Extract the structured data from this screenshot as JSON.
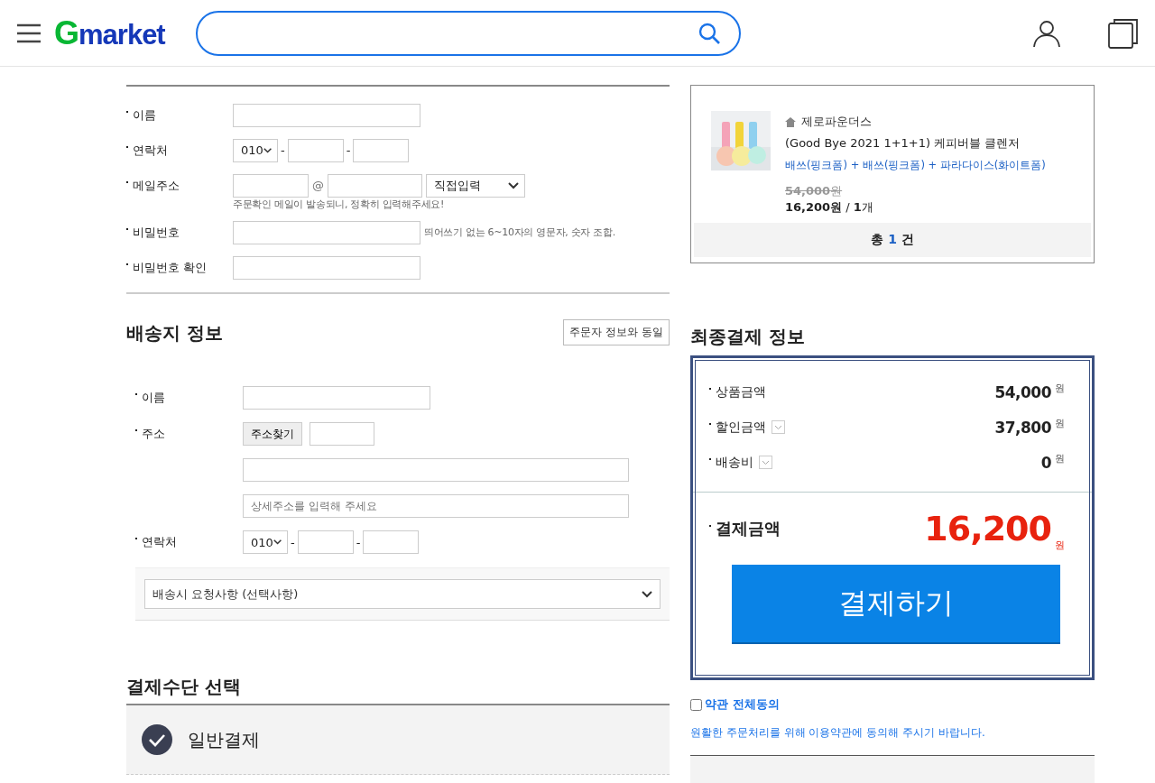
{
  "header": {
    "logo": {
      "mark": "G",
      "text": "market"
    }
  },
  "orderer": {
    "fields": [
      {
        "kind": "text",
        "label": "이름"
      },
      {
        "kind": "phone",
        "label": "연락처",
        "prefix": "010",
        "dash": "-"
      },
      {
        "kind": "email",
        "label": "메일주소",
        "at": "@",
        "domain": "직접입력",
        "note": "주문확인 메일이 발송되니, 정확히 입력해주세요!"
      },
      {
        "kind": "text",
        "label": "비밀번호",
        "hint": "띄어쓰기 없는 6~10자의 영문자, 숫자 조합."
      },
      {
        "kind": "text",
        "label": "비밀번호 확인"
      }
    ]
  },
  "delivery": {
    "title": "배송지 정보",
    "same_button": "주문자 정보와 동일",
    "fields": [
      {
        "kind": "text",
        "label": "이름"
      },
      {
        "kind": "address",
        "label": "주소",
        "button": "주소찾기",
        "detail_placeholder": "상세주소를 입력해 주세요"
      },
      {
        "kind": "phone",
        "label": "연락처",
        "prefix": "010",
        "dash": "-"
      }
    ],
    "request": "배송시 요청사항 (선택사항)"
  },
  "payment_method": {
    "title": "결제수단 선택",
    "options": [
      {
        "label": "일반결제",
        "selected": true
      }
    ]
  },
  "order_items": {
    "items": [
      {
        "kind": "picture",
        "seller": "제로파운더스",
        "name": "(Good Bye 2021 1+1+1) 케피버블 클렌저",
        "option": "배쓰(핑크폼) + 배쓰(핑크폼) + 파라다이스(화이트폼)",
        "original_price": "**54,000**원",
        "price_line": "**16,200원** / **1**개"
      }
    ],
    "total_prefix": "총",
    "total_count": "1",
    "total_suffix": "건"
  },
  "summary": {
    "title": "최종결제 정보",
    "rows": [
      {
        "label": "상품금액",
        "amount": "54,000",
        "unit": "원",
        "expandable": false
      },
      {
        "label": "할인금액",
        "amount": "37,800",
        "unit": "원",
        "expandable": true
      },
      {
        "label": "배송비",
        "amount": "0",
        "unit": "원",
        "expandable": true
      }
    ],
    "total": {
      "label": "결제금액",
      "amount": "16,200",
      "unit": "원"
    },
    "pay_button": "결제하기"
  },
  "terms": {
    "agree_all": {
      "label": "약관 전체동의",
      "checked": false
    },
    "note": "원활한 주문처리를 위해 이용약관에 동의해 주시기 바랍니다."
  }
}
